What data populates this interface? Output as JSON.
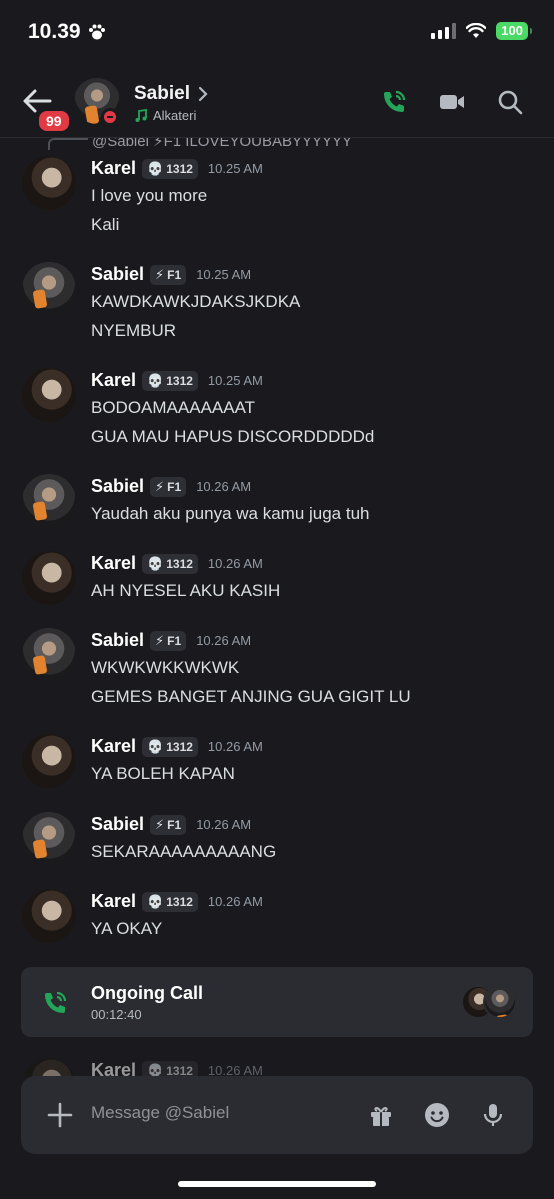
{
  "status_bar": {
    "time": "10.39",
    "battery": "100"
  },
  "header": {
    "unread_count": "99",
    "contact_name": "Sabiel",
    "activity": "Alkateri"
  },
  "reply_preview": "@Sabiel ⚡F1 ILOVEYOUBABYYYYYY",
  "messages": [
    {
      "user": "Karel",
      "tag_icon": "💀",
      "tag": "1312",
      "time": "10.25 AM",
      "lines": [
        "I love you more",
        "Kali"
      ]
    },
    {
      "user": "Sabiel",
      "tag_icon": "⚡",
      "tag": "F1",
      "time": "10.25 AM",
      "lines": [
        "KAWDKAWKJDAKSJKDKA",
        "NYEMBUR"
      ]
    },
    {
      "user": "Karel",
      "tag_icon": "💀",
      "tag": "1312",
      "time": "10.25 AM",
      "lines": [
        "BODOAMAAAAAAAT",
        "GUA MAU HAPUS DISCORDDDDDd"
      ]
    },
    {
      "user": "Sabiel",
      "tag_icon": "⚡",
      "tag": "F1",
      "time": "10.26 AM",
      "lines": [
        "Yaudah aku punya wa kamu juga tuh"
      ]
    },
    {
      "user": "Karel",
      "tag_icon": "💀",
      "tag": "1312",
      "time": "10.26 AM",
      "lines": [
        "AH NYESEL AKU KASIH"
      ]
    },
    {
      "user": "Sabiel",
      "tag_icon": "⚡",
      "tag": "F1",
      "time": "10.26 AM",
      "lines": [
        "WKWKWKKWKWK",
        "GEMES BANGET ANJING GUA GIGIT LU"
      ]
    },
    {
      "user": "Karel",
      "tag_icon": "💀",
      "tag": "1312",
      "time": "10.26 AM",
      "lines": [
        "YA BOLEH KAPAN"
      ]
    },
    {
      "user": "Sabiel",
      "tag_icon": "⚡",
      "tag": "F1",
      "time": "10.26 AM",
      "lines": [
        "SEKARAAAAAAAAANG"
      ]
    },
    {
      "user": "Karel",
      "tag_icon": "💀",
      "tag": "1312",
      "time": "10.26 AM",
      "lines": [
        "YA OKAY"
      ]
    },
    {
      "user": "Karel",
      "tag_icon": "💀",
      "tag": "1312",
      "time": "10.26 AM",
      "lines": []
    }
  ],
  "call": {
    "title": "Ongoing Call",
    "duration": "00:12:40"
  },
  "composer": {
    "placeholder": "Message @Sabiel"
  },
  "colors": {
    "accent_green": "#23a55a",
    "badge_red": "#e03a45",
    "background": "#1a1a1e"
  }
}
